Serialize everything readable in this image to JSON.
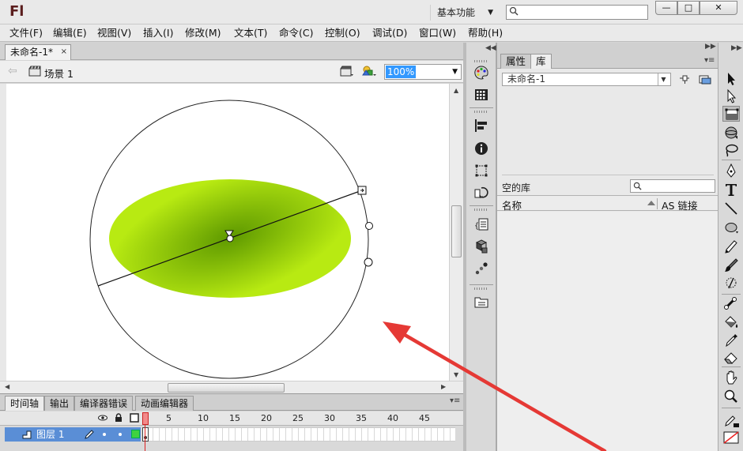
{
  "app": {
    "logo": "Fl",
    "workspace": "基本功能",
    "search_value": "",
    "window_buttons": {
      "minimize": "—",
      "maximize": "□",
      "close": "✕"
    }
  },
  "menu": [
    "文件(F)",
    "编辑(E)",
    "视图(V)",
    "插入(I)",
    "修改(M)",
    "文本(T)",
    "命令(C)",
    "控制(O)",
    "调试(D)",
    "窗口(W)",
    "帮助(H)"
  ],
  "document": {
    "tab_label": "未命名-1*",
    "close_glyph": "×",
    "scene_label": "场景 1",
    "zoom": "100%"
  },
  "timeline": {
    "tabs": [
      "时间轴",
      "输出",
      "编译器错误",
      "动画编辑器"
    ],
    "active_tab": 0,
    "frame_numbers": [
      "1",
      "5",
      "10",
      "15",
      "20",
      "25",
      "30",
      "35",
      "40",
      "45"
    ],
    "layer_name": "图层 1"
  },
  "library": {
    "tabs": [
      "属性",
      "库"
    ],
    "active_tab": 1,
    "document_select": "未命名-1",
    "empty_label": "空的库",
    "search_value": "",
    "col_name": "名称",
    "col_linkage": "AS 链接"
  },
  "panel_icons": [
    "color-palette-icon",
    "swatches-icon",
    "align-icon",
    "info-icon",
    "transform-icon",
    "history-icon",
    "code-snippets-icon",
    "components-icon",
    "motion-presets-icon",
    "project-icon"
  ],
  "tools": [
    "selection-tool-icon",
    "subselection-tool-icon",
    "free-transform-tool-icon",
    "3d-rotation-tool-icon",
    "lasso-tool-icon",
    "pen-tool-icon",
    "text-tool-icon",
    "line-tool-icon",
    "oval-tool-icon",
    "pencil-tool-icon",
    "brush-tool-icon",
    "deco-tool-icon",
    "bone-tool-icon",
    "paint-bucket-tool-icon",
    "eyedropper-tool-icon",
    "eraser-tool-icon",
    "hand-tool-icon",
    "zoom-tool-icon",
    "stroke-color-icon",
    "fill-color-icon"
  ],
  "colors": {
    "gradient_center": "#5e9900",
    "gradient_edge": "#b8ea12",
    "annotation_arrow": "#e53935",
    "layer_highlight": "#5a8ed6"
  }
}
